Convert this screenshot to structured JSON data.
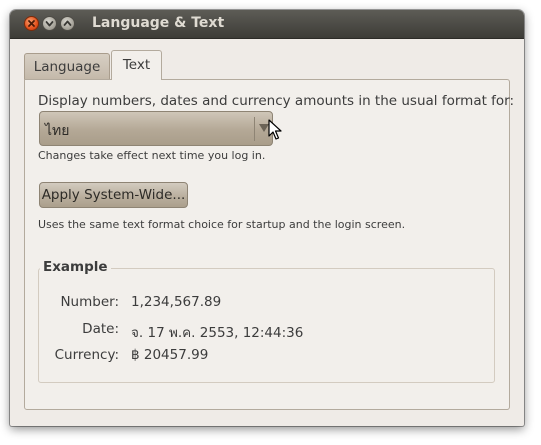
{
  "window": {
    "title": "Language & Text"
  },
  "titlebar": {
    "close_icon": "close-icon",
    "minimize_icon": "minimize-icon",
    "maximize_icon": "maximize-icon"
  },
  "tabs": [
    {
      "label": "Language",
      "selected": false
    },
    {
      "label": "Text",
      "selected": true
    }
  ],
  "text_tab": {
    "format_label": "Display numbers, dates and currency amounts in the usual format for:",
    "format_select": {
      "value": "ไทย",
      "arrow_icon": "dropdown-arrow-icon"
    },
    "format_hint": "Changes take effect next time you log in.",
    "apply_button": "Apply System-Wide...",
    "apply_hint": "Uses the same text format choice for startup and the login screen.",
    "example": {
      "title": "Example",
      "number_label": "Number:",
      "number_value": "1,234,567.89",
      "date_label": "Date:",
      "date_value": "จ. 17 พ.ค. 2553, 12:44:36",
      "currency_label": "Currency:",
      "currency_value": "฿ 20457.99"
    }
  },
  "colors": {
    "titlebar": "#3d3c37",
    "window_bg": "#efebe7",
    "close_button": "#e2511c",
    "button_bg": "#b8ad9c"
  }
}
